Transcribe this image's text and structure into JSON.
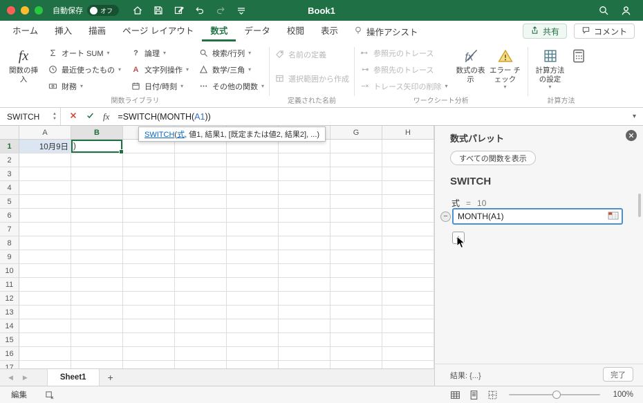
{
  "colors": {
    "excel_green": "#217346",
    "reference_blue": "#3b6cc0",
    "link_blue": "#0563c1"
  },
  "titlebar": {
    "autosave": "自動保存",
    "autosave_state": "オフ",
    "title": "Book1"
  },
  "ribbon": {
    "tabs": [
      {
        "key": "home",
        "label": "ホーム"
      },
      {
        "key": "insert",
        "label": "挿入"
      },
      {
        "key": "draw",
        "label": "描画"
      },
      {
        "key": "page-layout",
        "label": "ページ レイアウト"
      },
      {
        "key": "formulas",
        "label": "数式",
        "active": true
      },
      {
        "key": "data",
        "label": "データ"
      },
      {
        "key": "review",
        "label": "校閲"
      },
      {
        "key": "view",
        "label": "表示"
      }
    ],
    "assist": "操作アシスト",
    "share": "共有",
    "comments": "コメント",
    "insert_function": "関数の挿入",
    "lib": [
      "オート SUM",
      "最近使ったもの",
      "財務",
      "論理",
      "文字列操作",
      "日付/時刻",
      "検索/行列",
      "数学/三角",
      "その他の関数"
    ],
    "defined": [
      "名前の定義",
      "選択範囲から作成"
    ],
    "audit": [
      "参照元のトレース",
      "参照先のトレース",
      "トレース矢印の削除"
    ],
    "show_formulas": "数式の表示",
    "error_check": "エラー チェック",
    "calc_settings": "計算方法の設定",
    "group_labels": [
      "関数ライブラリ",
      "定義された名前",
      "ワークシート分析",
      "計算方法"
    ]
  },
  "formula_bar": {
    "name_box": "SWITCH",
    "formula": {
      "p1": "=SWITCH(MONTH(",
      "ref": "A1",
      "p2": "))"
    },
    "tooltip": {
      "fn": "SWITCH",
      "open": "(",
      "arg": "式",
      "rest": ", 値1, 結果1, [既定または値2, 結果2], ...)"
    }
  },
  "grid": {
    "columns": [
      "A",
      "B",
      "C",
      "D",
      "E",
      "F",
      "G",
      "H"
    ],
    "row_count": 17,
    "selected_cell": "B1",
    "selected_column": "B",
    "selected_row": 1,
    "cells": [
      {
        "ref": "A1",
        "text": "10月9日",
        "style": "ref-cell"
      },
      {
        "ref": "B1",
        "text": ")",
        "style": "edit-cell"
      }
    ]
  },
  "sheet_bar": {
    "tabs": [
      "Sheet1"
    ],
    "add_label": "+"
  },
  "panel": {
    "title": "数式パレット",
    "show_all": "すべての関数を表示",
    "function_name": "SWITCH",
    "arg_name": "式",
    "arg_eq": "=",
    "arg_value": "10",
    "input_value": "MONTH(A1)",
    "result": "結果: {...}",
    "done": "完了"
  },
  "status_bar": {
    "mode": "編集",
    "zoom": "100%"
  }
}
